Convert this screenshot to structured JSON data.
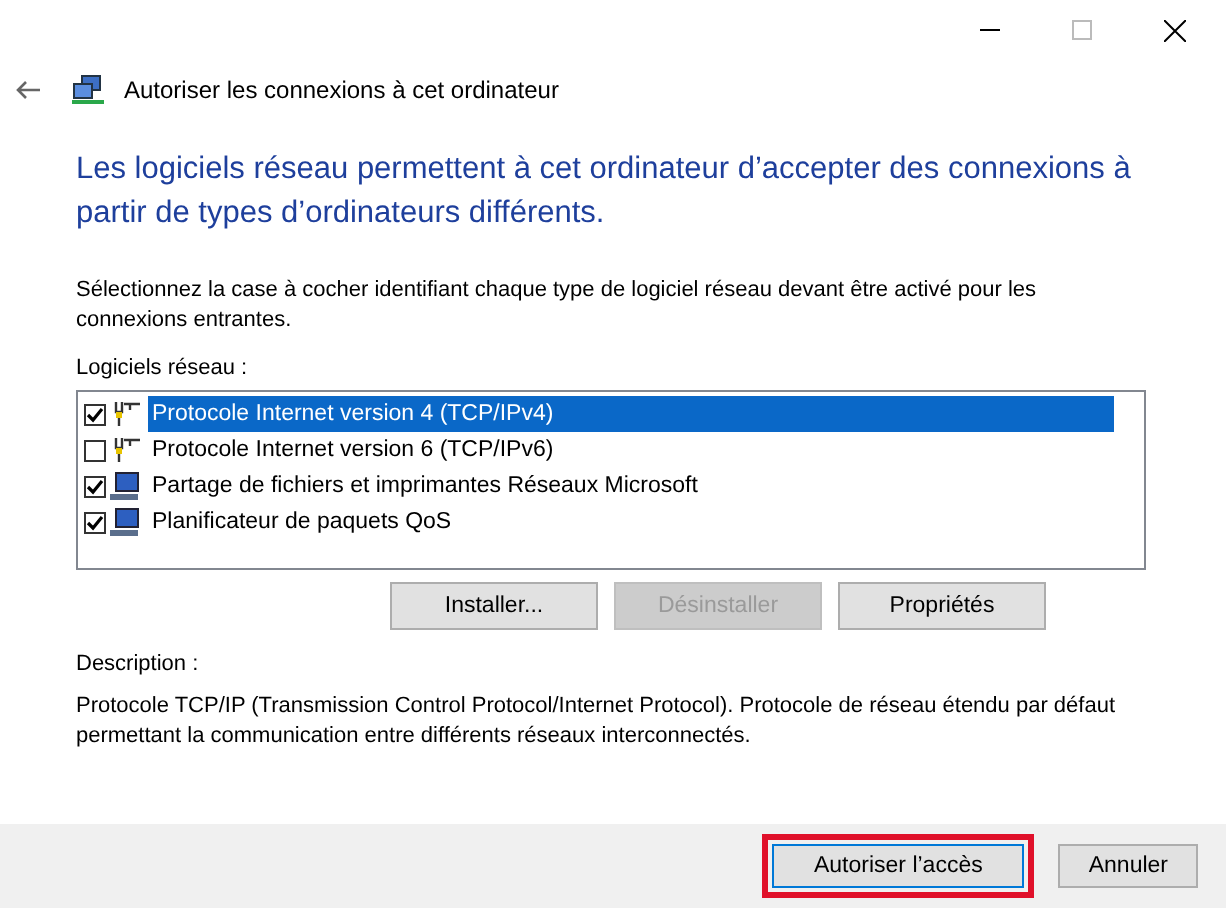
{
  "window": {
    "title": "Autoriser les connexions à cet ordinateur"
  },
  "heading": "Les logiciels réseau permettent à cet ordinateur d’accepter des connexions à partir de types d’ordinateurs différents.",
  "instruction": "Sélectionnez la case à cocher identifiant chaque type de logiciel réseau devant être activé pour les connexions entrantes.",
  "list_label": "Logiciels réseau :",
  "items": [
    {
      "label": "Protocole Internet version 4 (TCP/IPv4)",
      "kind": "protocol",
      "checked": true,
      "selected": true
    },
    {
      "label": "Protocole Internet version 6 (TCP/IPv6)",
      "kind": "protocol",
      "checked": false,
      "selected": false
    },
    {
      "label": "Partage de fichiers et imprimantes Réseaux Microsoft",
      "kind": "service",
      "checked": true,
      "selected": false
    },
    {
      "label": "Planificateur de paquets QoS",
      "kind": "service",
      "checked": true,
      "selected": false
    }
  ],
  "list_buttons": [
    {
      "label": "Installer...",
      "disabled": false
    },
    {
      "label": "Désinstaller",
      "disabled": true
    },
    {
      "label": "Propriétés",
      "disabled": false
    }
  ],
  "description_label": "Description :",
  "description": "Protocole TCP/IP (Transmission Control Protocol/Internet Protocol). Protocole de réseau étendu par défaut permettant la communication entre différents réseaux interconnectés.",
  "footer_buttons": [
    {
      "label": "Autoriser l’accès",
      "highlighted": true
    },
    {
      "label": "Annuler",
      "highlighted": false
    }
  ]
}
